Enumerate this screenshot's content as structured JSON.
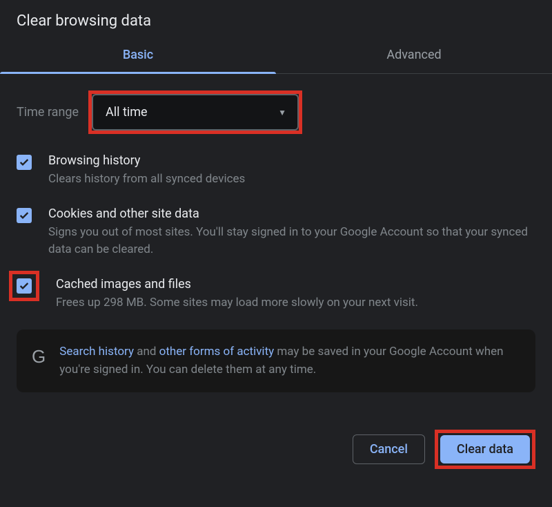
{
  "title": "Clear browsing data",
  "tabs": {
    "basic": "Basic",
    "advanced": "Advanced"
  },
  "timeRange": {
    "label": "Time range",
    "value": "All time"
  },
  "options": {
    "browsingHistory": {
      "title": "Browsing history",
      "desc": "Clears history from all synced devices"
    },
    "cookies": {
      "title": "Cookies and other site data",
      "desc": "Signs you out of most sites. You'll stay signed in to your Google Account so that your synced data can be cleared."
    },
    "cached": {
      "title": "Cached images and files",
      "desc": "Frees up 298 MB. Some sites may load more slowly on your next visit."
    }
  },
  "info": {
    "link1": "Search history",
    "mid1": " and ",
    "link2": "other forms of activity",
    "rest": " may be saved in your Google Account when you're signed in. You can delete them at any time."
  },
  "buttons": {
    "cancel": "Cancel",
    "clear": "Clear data"
  }
}
